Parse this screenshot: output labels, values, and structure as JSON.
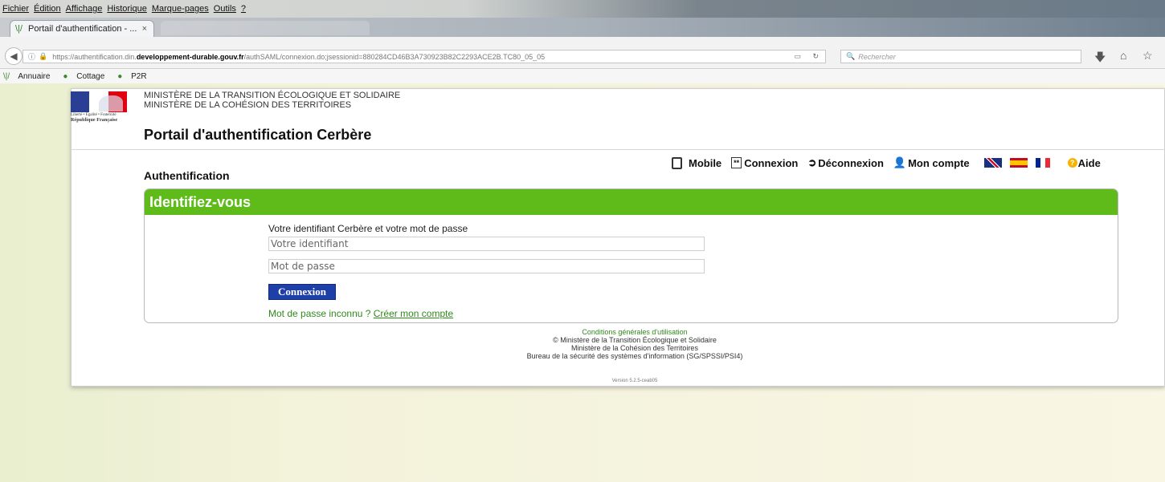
{
  "browser": {
    "menus": [
      "Fichier",
      "Édition",
      "Affichage",
      "Historique",
      "Marque-pages",
      "Outils",
      "?"
    ],
    "tab": {
      "title": "Portail d'authentification - ...",
      "close": "×"
    },
    "url": {
      "prefix": "https://authentification.din.",
      "domain": "developpement-durable.gouv.fr",
      "path": "/authSAML/connexion.do;jsessionid=880284CD46B3A730923B82C2293ACE2B.TC80_05_05"
    },
    "search_placeholder": "Rechercher",
    "bookmarks": [
      "Annuaire",
      "Cottage",
      "P2R"
    ]
  },
  "header": {
    "logo_motto": "Liberté • Égalité • Fraternité",
    "logo_name": "République Française",
    "ministry_line1": "MINISTÈRE DE LA TRANSITION ÉCOLOGIQUE ET SOLIDAIRE",
    "ministry_line2": "MINISTÈRE DE LA COHÉSION DES TERRITOIRES",
    "portal_title": "Portail d'authentification Cerbère"
  },
  "topnav": {
    "mobile": "Mobile",
    "connexion": "Connexion",
    "deconnexion": "Déconnexion",
    "mon_compte": "Mon compte",
    "aide": "Aide",
    "connexion_icon": "**"
  },
  "auth": {
    "section_title": "Authentification",
    "panel_title": "Identifiez-vous",
    "label": "Votre identifiant Cerbère et votre mot de passe",
    "username_placeholder": "Votre identifiant",
    "password_placeholder": "Mot de passe",
    "submit_label": "Connexion",
    "forgot_text": "Mot de passe inconnu ? ",
    "create_account": "Créer mon compte"
  },
  "footer": {
    "cgu": "Conditions générales d'utilisation",
    "copyright": "© Ministère de la Transition Écologique et Solidaire",
    "ministry2": "Ministère de la Cohésion des Territoires",
    "bureau": "Bureau de la sécurité des systèmes d'information (SG/SPSSI/PSI4)",
    "version": "Version 5.2.5-ceab05"
  },
  "colors": {
    "panel_header": "#5fbb1a",
    "button": "#1f3fa8",
    "link_green": "#2e8b1a"
  }
}
